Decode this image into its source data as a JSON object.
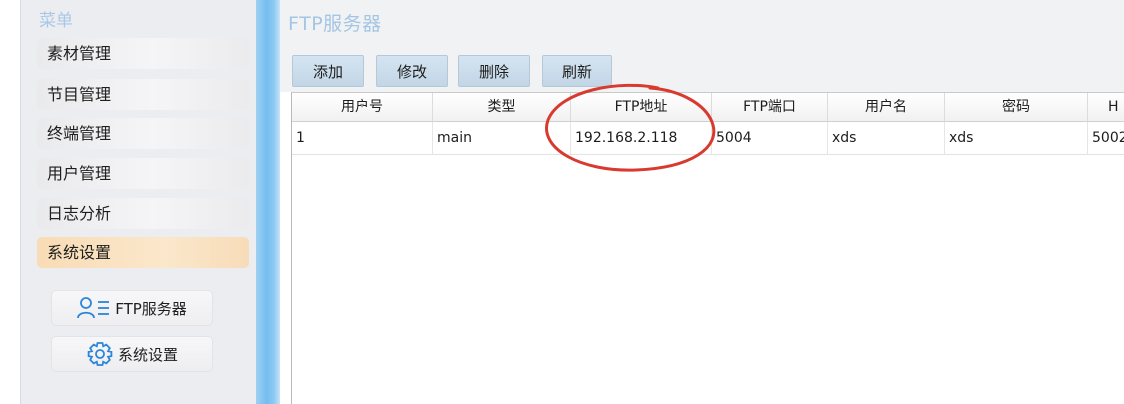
{
  "sidebar": {
    "title": "菜单",
    "items": [
      {
        "label": "素材管理"
      },
      {
        "label": "节目管理"
      },
      {
        "label": "终端管理"
      },
      {
        "label": "用户管理"
      },
      {
        "label": "日志分析"
      },
      {
        "label": "系统设置",
        "active": true
      }
    ],
    "sub_items": [
      {
        "label": "FTP服务器",
        "icon": "user-list-icon"
      },
      {
        "label": "系统设置",
        "icon": "gear-icon"
      }
    ]
  },
  "page": {
    "title": "FTP服务器"
  },
  "toolbar": {
    "buttons": [
      {
        "label": "添加"
      },
      {
        "label": "修改"
      },
      {
        "label": "删除"
      },
      {
        "label": "刷新"
      }
    ]
  },
  "table": {
    "columns": [
      "用户号",
      "类型",
      "FTP地址",
      "FTP端口",
      "用户名",
      "密码",
      "H"
    ],
    "rows": [
      [
        "1",
        "main",
        "192.168.2.118",
        "5004",
        "xds",
        "xds",
        "5002"
      ]
    ]
  },
  "colors": {
    "annotation_circle": "#d93a2f",
    "active_menu": "#f8dcb5",
    "toolbar_button": "#c8dae9",
    "divider": "#74bdf0"
  }
}
